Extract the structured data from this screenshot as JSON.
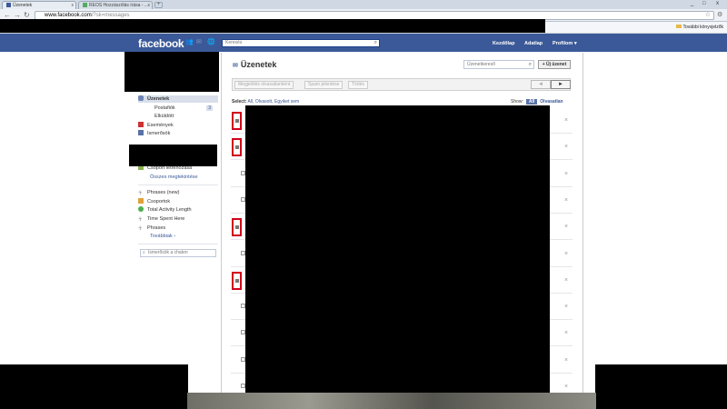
{
  "browser": {
    "tabs": [
      {
        "label": "Üzenetek",
        "active": true
      },
      {
        "label": "REOS Hozzászólás írása - ...",
        "active": false
      }
    ],
    "window_controls": [
      "_",
      "□",
      "x"
    ],
    "url_host": "www.facebook.com",
    "url_path": "/?sk=messages",
    "other_bookmarks": "További könyvjelzők"
  },
  "topbar": {
    "logo": "facebook",
    "search_placeholder": "Keresés",
    "links": [
      "Kezdőlap",
      "Adatlap",
      "Profilom ▾"
    ]
  },
  "sidebar": {
    "items": [
      {
        "label": "Üzenetek",
        "icon": "messages-icon",
        "selected": true
      },
      {
        "label": "Postafiók",
        "count": "3",
        "sub": true
      },
      {
        "label": "Elküldött",
        "sub": true
      },
      {
        "label": "Események",
        "icon": "calendar-icon"
      },
      {
        "label": "Ismerősök",
        "icon": "friends-icon"
      },
      {
        "label": "Csoport létrehozása",
        "icon": "group-add-icon"
      },
      {
        "label": "Összes megtekintése",
        "link": true
      },
      {
        "label": "Phrases (new)",
        "icon": "app-icon"
      },
      {
        "label": "Csoportok",
        "icon": "groups-icon"
      },
      {
        "label": "Total Activity Length",
        "icon": "app-icon"
      },
      {
        "label": "Time Spent Here",
        "icon": "app-icon"
      },
      {
        "label": "Phrases",
        "icon": "app-icon"
      },
      {
        "label": "Továbbiak ›",
        "link": true
      }
    ],
    "chat_search_placeholder": "Ismerősök a chaten"
  },
  "main": {
    "title": "Üzenetek",
    "search_placeholder": "Üzenetkereső",
    "new_message": "+ Új üzenet",
    "actions": [
      "Megjelölés olvasatlanként",
      "Spam jelentése",
      "Törlés"
    ],
    "pager": {
      "prev": "◄",
      "next": "►"
    },
    "select_label": "Select:",
    "select_options": "All, Olvasott, Egyiket sem",
    "show_label": "Show:",
    "show_all": "All",
    "show_unread": "Olvasatlan"
  }
}
